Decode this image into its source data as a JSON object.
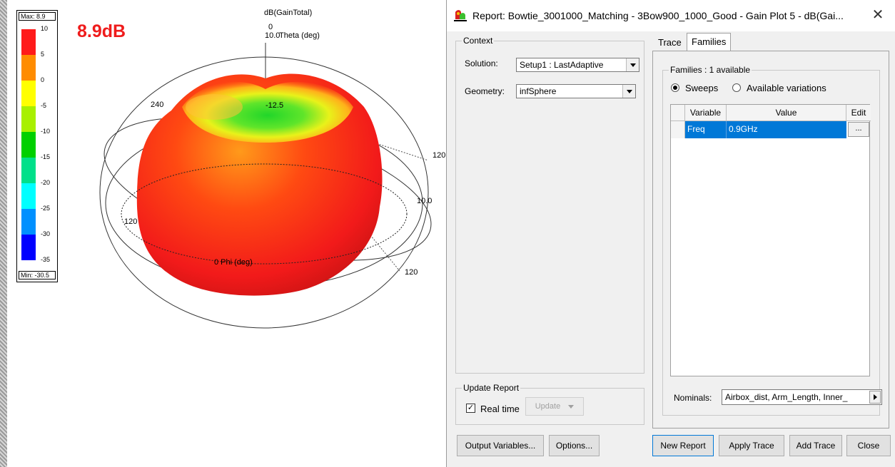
{
  "plot": {
    "peak_label": "8.9dB",
    "title": "dB(GainTotal)",
    "legend": {
      "max_label": "Max: 8.9",
      "min_label": "Min: -30.5",
      "colors": [
        "#ff1a1a",
        "#ff8c00",
        "#ffff00",
        "#a8f000",
        "#00d000",
        "#00e08a",
        "#00ffff",
        "#0090ff",
        "#0000ff"
      ],
      "ticks": [
        "10",
        "5",
        "0",
        "-5",
        "-10",
        "-15",
        "-20",
        "-25",
        "-30",
        "-35"
      ]
    },
    "axes": {
      "theta_zero": "0",
      "theta_r": "10.0",
      "theta_label": "Theta (deg)",
      "ring_mid": "-12.5",
      "label_240": "240",
      "label_120_right": "120",
      "label_10_right": "10.0",
      "label_120_left": "120",
      "phi_label": "0 Phi (deg)",
      "label_120_bottom": "120"
    }
  },
  "dialog": {
    "title": "Report: Bowtie_3001000_Matching - 3Bow900_1000_Good - Gain Plot 5 - dB(Gai...",
    "close_symbol": "✕",
    "context": {
      "group_label": "Context",
      "solution_label": "Solution:",
      "solution_value": "Setup1 : LastAdaptive",
      "geometry_label": "Geometry:",
      "geometry_value": "infSphere"
    },
    "update_report": {
      "group_label": "Update Report",
      "realtime_label": "Real time",
      "realtime_checked": "✓",
      "update_label": "Update"
    },
    "tabs": [
      "Trace",
      "Families"
    ],
    "families": {
      "group_label": "Families : 1 available",
      "radio_sweeps": "Sweeps",
      "radio_variations": "Available variations",
      "headers": [
        "Variable",
        "Value",
        "Edit"
      ],
      "row": {
        "variable": "Freq",
        "value": "0.9GHz",
        "edit": "..."
      },
      "nominals_label": "Nominals:",
      "nominals_value": "Airbox_dist, Arm_Length, Inner_"
    },
    "buttons": {
      "output_variables": "Output Variables...",
      "options": "Options...",
      "new_report": "New Report",
      "apply_trace": "Apply Trace",
      "add_trace": "Add Trace",
      "close": "Close"
    }
  }
}
